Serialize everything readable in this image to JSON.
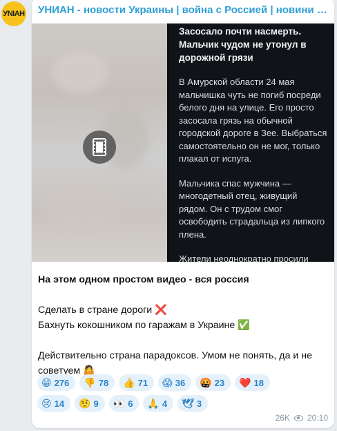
{
  "channel": {
    "name": "УНИАН - новости Украины | война с Россией | новини Україні…",
    "avatar_text": "УNIАН",
    "avatar_color": "#f6c21b"
  },
  "media": {
    "type": "video",
    "play_icon": "film-strip-icon",
    "article": {
      "title": "Засосало почти насмерть. Мальчик чудом не утонул в дорожной грязи",
      "paragraphs": [
        "В Амурской области 24 мая мальчишка чуть не погиб посреди белого дня на улице. Его просто засосала грязь на обычной городской дороге в Зее. Выбраться самостоятельно он не мог, только плакал от испуга.",
        "Мальчика спас мужчина — многодетный отец, живущий рядом. Он с трудом смог освободить страдальца из липкого плена.",
        "Жители неоднократно просили засыпать ямы на проезжей части, но проблема не решалась. И вот — такое ЧП. На место вопиющего случая были вызваны сотрудники полиции."
      ]
    }
  },
  "message": {
    "line1": "На этом одном простом видео - вся россия",
    "line2": "Сделать в стране дороги ❌",
    "line3": "Бахнуть кокошником по гаражам в Украине ✅",
    "line4": "Действительно страна парадоксов. Умом не понять, да и не советуем 🤷"
  },
  "reactions": {
    "row1": [
      {
        "emoji": "😁",
        "count": "276"
      },
      {
        "emoji": "👎",
        "count": "78"
      },
      {
        "emoji": "👍",
        "count": "71"
      },
      {
        "emoji": "😱",
        "count": "36"
      },
      {
        "emoji": "🤬",
        "count": "23"
      },
      {
        "emoji": "❤️",
        "count": "18"
      }
    ],
    "row2": [
      {
        "emoji": "😢",
        "count": "14"
      },
      {
        "emoji": "🤨",
        "count": "9"
      },
      {
        "emoji": "👀",
        "count": "6"
      },
      {
        "emoji": "🙏",
        "count": "4"
      },
      {
        "emoji": "🕊",
        "count": "3"
      }
    ]
  },
  "footer": {
    "views": "26K",
    "time": "20:10",
    "views_icon": "eye-icon"
  }
}
